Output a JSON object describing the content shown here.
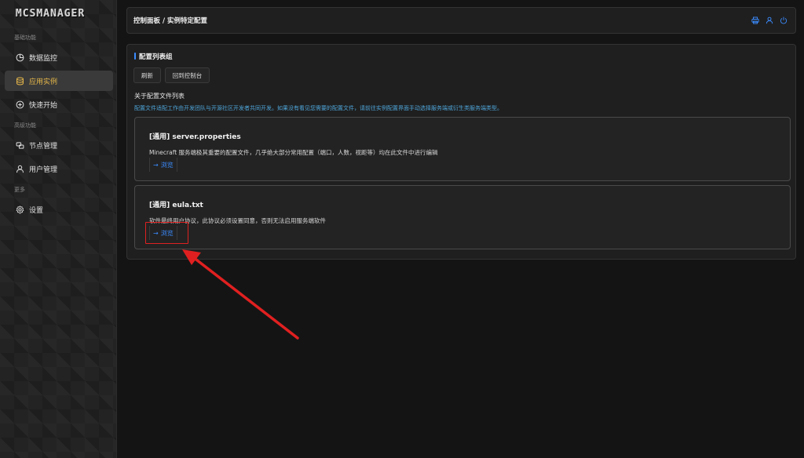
{
  "app": {
    "logo_text": "MCSMANAGER"
  },
  "sidebar": {
    "groups": [
      {
        "label": "基础功能"
      },
      {
        "label": "高级功能"
      },
      {
        "label": "更多"
      }
    ],
    "items": [
      {
        "label": "数据监控",
        "icon": "dashboard-icon"
      },
      {
        "label": "应用实例",
        "icon": "database-icon",
        "active": true
      },
      {
        "label": "快速开始",
        "icon": "plus-circle-icon"
      },
      {
        "label": "节点管理",
        "icon": "nodes-icon"
      },
      {
        "label": "用户管理",
        "icon": "user-icon"
      },
      {
        "label": "设置",
        "icon": "gear-icon"
      }
    ]
  },
  "header": {
    "breadcrumb": "控制面板 / 实例特定配置",
    "icons": [
      "printer-icon",
      "user-icon",
      "power-icon"
    ]
  },
  "main": {
    "section_title": "配置列表组",
    "refresh_label": "刷新",
    "back_label": "回到控制台",
    "about_title": "关于配置文件列表",
    "about_desc": "配置文件适配工作由开发团队与开源社区开发者共同开发。如果没有看见您需要的配置文件，请前往实例配置界面手动选择服务端或衍生类服务端类型。",
    "configs": [
      {
        "title": "[通用] server.properties",
        "desc": "Minecraft 服务端极其重要的配置文件，几乎绝大部分常用配置（端口，人数，视距等）均在此文件中进行编辑",
        "browse_label": "浏览"
      },
      {
        "title": "[通用] eula.txt",
        "desc": "软件最终用户协议，此协议必须设置同意，否则无法启用服务端软件",
        "browse_label": "浏览"
      }
    ]
  },
  "colors": {
    "accent": "#3b8cff",
    "active_nav": "#e9b94a",
    "annotation": "#e02020",
    "info_text": "#4ea5d9"
  }
}
